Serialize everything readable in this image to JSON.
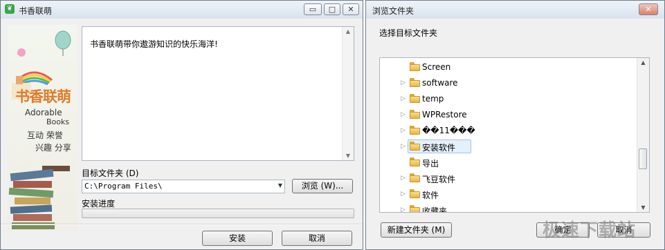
{
  "installer": {
    "title": "书香联萌",
    "window_buttons": {
      "minimize": "▭",
      "maximize": "□",
      "close": "✕"
    },
    "side_panel": {
      "logo_text": "书香联萌",
      "tagline1": "Adorable",
      "tagline2": "Books",
      "tags_line1": "互动 荣誉",
      "tags_line2": "兴趣 分享"
    },
    "description": "书香联萌带你遨游知识的快乐海洋!",
    "target_label": "目标文件夹 (D)",
    "target_path": "C:\\Program Files\\",
    "browse_label": "浏览 (W)...",
    "progress_label": "安装进度",
    "progress": 0,
    "install_label": "安装",
    "cancel_label": "取消"
  },
  "browse_dialog": {
    "title": "浏览文件夹",
    "close": "✕",
    "prompt": "选择目标文件夹",
    "folders": [
      {
        "name": "Screen",
        "expandable": false,
        "selected": false
      },
      {
        "name": "software",
        "expandable": true,
        "selected": false
      },
      {
        "name": "temp",
        "expandable": true,
        "selected": false
      },
      {
        "name": "WPRestore",
        "expandable": true,
        "selected": false
      },
      {
        "name": "��11���",
        "expandable": true,
        "selected": false
      },
      {
        "name": "安装软件",
        "expandable": true,
        "selected": true
      },
      {
        "name": "导出",
        "expandable": false,
        "selected": false
      },
      {
        "name": "飞豆软件",
        "expandable": true,
        "selected": false
      },
      {
        "name": "软件",
        "expandable": true,
        "selected": false
      },
      {
        "name": "收藏夹",
        "expandable": true,
        "selected": false
      }
    ],
    "new_folder_label": "新建文件夹 (M)",
    "ok_label": "确定",
    "cancel_label": "取消",
    "watermark": "极速下载站"
  },
  "colors": {
    "accent": "#3ea34a",
    "selection": "#e4f0fb"
  }
}
